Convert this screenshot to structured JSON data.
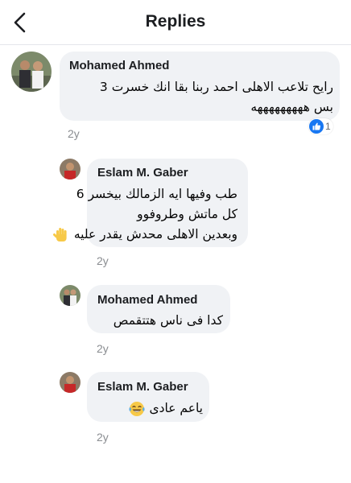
{
  "header": {
    "title": "Replies"
  },
  "comments": [
    {
      "author": "Mohamed Ahmed",
      "lines": [
        "رايح تلاعب الاهلى احمد ربنا بقا انك خسرت 3",
        "بس هههههههههه"
      ],
      "time": "2y",
      "reaction_count": "1"
    },
    {
      "author": "Eslam M. Gaber",
      "lines": [
        "طب وفيها ايه الزمالك بيخسر 6",
        "كل ماتش وطروفوو",
        "وبعدين الاهلى محدش يقدر عليه"
      ],
      "time": "2y"
    },
    {
      "author": "Mohamed Ahmed",
      "lines": [
        "كدا فى ناس هتتقمص"
      ],
      "time": "2y"
    },
    {
      "author": "Eslam M. Gaber",
      "lines": [
        "ياعم عادى"
      ],
      "time": "2y"
    }
  ],
  "icons": {
    "back": "chevron-left-icon",
    "reaction": "like-icon",
    "hand_emoji": "raised-hand-emoji",
    "laugh_emoji": "tears-of-joy-emoji"
  },
  "colors": {
    "bubble": "#f0f2f5",
    "like_blue": "#1877f2",
    "timestamp": "#8a8d91"
  }
}
